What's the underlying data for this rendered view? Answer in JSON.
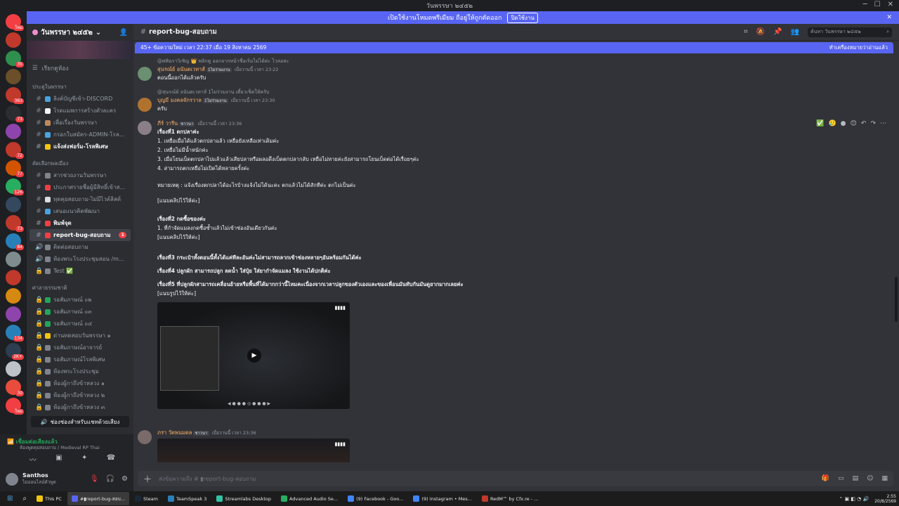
{
  "window": {
    "title": "วันพรรษา ๒๔๕๒",
    "left_icons": "⌐",
    "controls": [
      "─",
      "☐",
      "✕"
    ]
  },
  "banner": {
    "text": "เปิดใช้งานโหมดพรีเมียม ถือยู่ให้ถูกตัดออก",
    "button": "ปิดใช้งาน",
    "close": "✕"
  },
  "server_rail": {
    "icons": [
      {
        "color": "#f23f43",
        "badge": "ใหม่"
      },
      {
        "color": "#c0392b",
        "badge": ""
      },
      {
        "color": "#2f8f4e",
        "badge": "35"
      },
      {
        "color": "#6b4f2a",
        "badge": ""
      },
      {
        "color": "#c0392b",
        "badge": "363"
      },
      {
        "color": "#2b2d31",
        "badge": "73"
      },
      {
        "color": "#8e44ad",
        "badge": ""
      },
      {
        "color": "#c0392b",
        "badge": "72"
      },
      {
        "color": "#d35400",
        "badge": "77"
      },
      {
        "color": "#27ae60",
        "badge": "126"
      },
      {
        "color": "#34495e",
        "badge": ""
      },
      {
        "color": "#c0392b",
        "badge": "73"
      },
      {
        "color": "#2980b9",
        "badge": "84"
      },
      {
        "color": "#7f8c8d",
        "badge": ""
      },
      {
        "color": "#c0392b",
        "badge": ""
      },
      {
        "color": "#d68910",
        "badge": ""
      },
      {
        "color": "#8e44ad",
        "badge": ""
      },
      {
        "color": "#2980b9",
        "badge": "134"
      },
      {
        "color": "#2c3e50",
        "badge": "2K+"
      },
      {
        "color": "#bdc3c7",
        "badge": ""
      },
      {
        "color": "#e74c3c",
        "badge": "30"
      },
      {
        "color": "#f23f43",
        "badge": "ใหม่"
      }
    ]
  },
  "guild": {
    "name": "วันพรรษา ๒๔๕๒",
    "browse_channels": "เรียกดูห้อง",
    "categories": [
      {
        "name": "ประตูในพรรษา",
        "channels": [
          {
            "label": "ลิงค์บัญชีเข้า-DISCORD",
            "icon": "#",
            "color": "#4aa3df",
            "bold": false,
            "badge": ""
          },
          {
            "label": "โรดแมพการสร้างตัวละคร",
            "icon": "#",
            "color": "#f2f3f5",
            "bold": false,
            "badge": ""
          },
          {
            "label": "เพื่อเรื่องวันพรรษา",
            "icon": "#",
            "color": "#c08a5a",
            "bold": false,
            "badge": ""
          },
          {
            "label": "กรอกใบสมัคร-ADMIN-โรล...",
            "icon": "#",
            "color": "#4aa3df",
            "bold": false,
            "badge": ""
          },
          {
            "label": "แจ้งส่งฟอร์ม-โรลพิเศษ",
            "icon": "#",
            "color": "#f1c40f",
            "bold": true,
            "badge": ""
          }
        ]
      },
      {
        "name": "คัดเลือกพลเมือง",
        "channels": [
          {
            "label": "สารช่วยงานวันพรรษา",
            "icon": "#",
            "color": "#80848e",
            "bold": false,
            "badge": ""
          },
          {
            "label": "ประกาศรายชื่อผู้มีสิทธิ์เข้าส...",
            "icon": "#",
            "color": "#f23f43",
            "bold": false,
            "badge": ""
          },
          {
            "label": "ทุดคุยสอบถาม-ไม่มีไวต์ลิสต์",
            "icon": "#",
            "color": "#dbdee1",
            "bold": false,
            "badge": ""
          },
          {
            "label": "เสนอแนวคิดพัฒนา",
            "icon": "#",
            "color": "#4aa3df",
            "bold": false,
            "badge": ""
          },
          {
            "label": "พิมพ์จุด",
            "icon": "#",
            "color": "#f23f43",
            "bold": true,
            "badge": ""
          },
          {
            "label": "report-bug-สอบถาม",
            "icon": "#",
            "color": "#f23f43",
            "bold": true,
            "badge": "1",
            "active": true
          },
          {
            "label": "ติดต่อสอบถาม",
            "icon": "🔊",
            "color": "#80848e",
            "bold": false,
            "badge": ""
          },
          {
            "label": "ห้องพระโรงประชุมสอน /m...",
            "icon": "🔊",
            "color": "#80848e",
            "bold": false,
            "badge": ""
          },
          {
            "label": "Test ✅",
            "icon": "🔒",
            "color": "#80848e",
            "bold": false,
            "badge": ""
          }
        ]
      },
      {
        "name": "ศาลาธรรมชาติ",
        "channels": [
          {
            "label": "รอสัมภาษณ์ ๐๒",
            "icon": "🔒",
            "color": "#23a55a",
            "bold": false,
            "badge": ""
          },
          {
            "label": "รอสัมภาษณ์ ๐๓",
            "icon": "🔒",
            "color": "#23a55a",
            "bold": false,
            "badge": ""
          },
          {
            "label": "รอสัมภาษณ์ ๐๔",
            "icon": "🔒",
            "color": "#23a55a",
            "bold": false,
            "badge": ""
          },
          {
            "label": "ด่านทดสอบวันพรรษา ๑",
            "icon": "🔒",
            "color": "#f1c40f",
            "bold": false,
            "badge": ""
          },
          {
            "label": "รอสัมภาษณ์อาจารย์",
            "icon": "🔒",
            "color": "#80848e",
            "bold": false,
            "badge": ""
          },
          {
            "label": "รอสัมภาษณ์โรลพิเศษ",
            "icon": "🔒",
            "color": "#80848e",
            "bold": false,
            "badge": ""
          },
          {
            "label": "ห้องพระโรงประชุม",
            "icon": "🔒",
            "color": "#80848e",
            "bold": false,
            "badge": ""
          },
          {
            "label": "ห้องผู้กาถึงข้าหลวง ๑",
            "icon": "🔒",
            "color": "#80848e",
            "bold": false,
            "badge": ""
          },
          {
            "label": "ห้องผู้กาถึงข้าหลวง ๒",
            "icon": "🔒",
            "color": "#80848e",
            "bold": false,
            "badge": ""
          },
          {
            "label": "ห้องผู้กาถึงข้าหลวง ๓",
            "icon": "🔒",
            "color": "#80848e",
            "bold": false,
            "badge": ""
          }
        ]
      }
    ],
    "voice_button": "ช่องช่องสำหรับแชทด้วยเสียง"
  },
  "voice": {
    "status": "เชื่อมต่อเสียงแล้ว",
    "channel": "ห้องพูดคุยสอบถาม / Medieval RP Thai"
  },
  "user": {
    "name": "Santhos",
    "status": "ไม่ออนไลน์ตัวพูด"
  },
  "channel_header": {
    "name": "report-bug-สอบถาม",
    "search_placeholder": "ค้นหา วันพรรษา ๒๔๕๒"
  },
  "new_messages_bar": {
    "text": "45+ ข้อความใหม่ เวลา 22:37 เมื่อ 19 สิงหาคม 2569",
    "mark_read": "ทำเครื่องหมายว่าอ่านแล้ว"
  },
  "messages": [
    {
      "reply": "@ศศิฉราวิเชิญ 👑 พลิกตู  ออกจากหน้าชื่อเริ่มไม่ได้ค่ะ ไวลอสะ",
      "author": "สุนรณ์ย์ อนันตเวหาส์",
      "author_color": "#c08a5a",
      "tag": "1ไม่ร่วมงาน",
      "timestamp": "เมื่อวานนี้ เวลา 23:22",
      "lines": [
        "ตอนนี้ออกได้แล้วครับ"
      ],
      "avatar_color": "#6b8f71"
    },
    {
      "reply": "@สุนรณ์ย์ อนันตเวหาส์ 1ไม่ร่วมงาน  เดี๋ยวเช็คให้ครับ",
      "author": "บุญมี มงคลจักรวาล",
      "author_color": "#c08a5a",
      "tag": "1ไม่ร่วมงาน",
      "timestamp": "เมื่อวานนี้ เวลา 23:30",
      "lines": [
        "ครับ"
      ],
      "avatar_color": "#b0732f"
    },
    {
      "reply": "",
      "author": "ภีร์ วารีน",
      "author_color": "#c08a5a",
      "tag": "ชาวนา",
      "timestamp": "เมื่อวานนี้ เวลา 23:36",
      "lines": [
        "เรื่องที่1 ตกปลาค่ะ",
        "1. เหยื่อเมื่อได้แล้วตกปลาแล้ว เหยื่อยังเหลือเท่าเดิมค่ะ",
        "2. เหยื่อไม่มีน้ำหนักค่ะ",
        "3. เมื่อโยนเบ็ดตกปลาไปแล้วแล้วเสียปลาหรือผลอดึงเบ็ดตกปลากลับ เหยื่อไม่หายค่ะยังสามารถโยนเบ็ดต่อได้เรื่อยๆค่ะ",
        "4. สามารถตกเหยื่อไม่เปิดได้หลายครั้งค่ะ",
        "หมายเหตุ : แจ้งเรื่องตกปลาได้อะไรบ้างแจ้งไม่ได้นะคะ ตกแล้วไม่ได้สักทีค่ะ ตกไม่เป็นค่ะ",
        "[แนบคลิปไว้ให้ค่ะ]",
        "เรื่องที่2  กดซื้อของค่ะ",
        "1. ที่กำจัดแมลงกดซื้อซ้ำแล้วไม่เข้าช่องอันเดียวกันค่ะ",
        "[แนบคลิปไว้ให้ค่ะ]",
        "เรื่องที่3  กระเป๋าทั้งตอนนี้ทั้งได้แค่ทีละอันค่ะไม่สามารถลากเข้าช่องหลายๆอันพร้อมกันได้ค่ะ",
        "เรื่องที่4  ปลูกผัก สามารถปลูก ลดน้ำ ใส่ปุ๋ย ใส่ยากำจัดแมลง ใช้งานได้ปกติค่ะ",
        "เรื่องที่5  ที่ปลูกผักสามารถเคลื่อนย้ายหรือพื้นที่ได้มากกว่านี้ไหมคะเนื่องจากเวลาปลูกของตัวเองและของเพื่อนมันทับกันมันดูยากมากเลยค่ะ",
        "[แนบรูปไว้ให้ค่ะ]"
      ],
      "avatar_color": "#8a7f86"
    },
    {
      "reply": "",
      "author": "ภรา วัดพนมดล",
      "author_color": "#c08a5a",
      "tag": "ชาวนา",
      "timestamp": "เมื่อวานนี้ เวลา 23:36",
      "lines": [],
      "avatar_color": "#7a6a6a"
    }
  ],
  "video": {
    "tag": "▮▮▮▮",
    "hud": "◀ ● ● ● ◎ ● ● ● ▶"
  },
  "message_actions": [
    "✅",
    "🥲",
    "●",
    "😊",
    "↶",
    "↷",
    "⋯"
  ],
  "composer": {
    "placeholder": "ส่งข้อความถึง # ▮report-bug-สอบถาม"
  },
  "taskbar": {
    "items": [
      {
        "label": "This PC",
        "color": "#f1c40f",
        "active": false
      },
      {
        "label": "#▮report-bug-สอบ...",
        "color": "#5865f2",
        "active": true
      },
      {
        "label": "Steam",
        "color": "#1b2838",
        "active": false
      },
      {
        "label": "TeamSpeak 3",
        "color": "#2980b9",
        "active": false
      },
      {
        "label": "Streamlabs Desktop",
        "color": "#31c3a2",
        "active": false
      },
      {
        "label": "Advanced Audio Se...",
        "color": "#27ae60",
        "active": false
      },
      {
        "label": "(9) Facebook - Goo...",
        "color": "#4285f4",
        "active": false
      },
      {
        "label": "(9) Instagram • Mes...",
        "color": "#4285f4",
        "active": false
      },
      {
        "label": "RedM™ by Cfx.re - ...",
        "color": "#c0392b",
        "active": false
      }
    ],
    "time": "2:55",
    "date": "20/8/2569"
  }
}
